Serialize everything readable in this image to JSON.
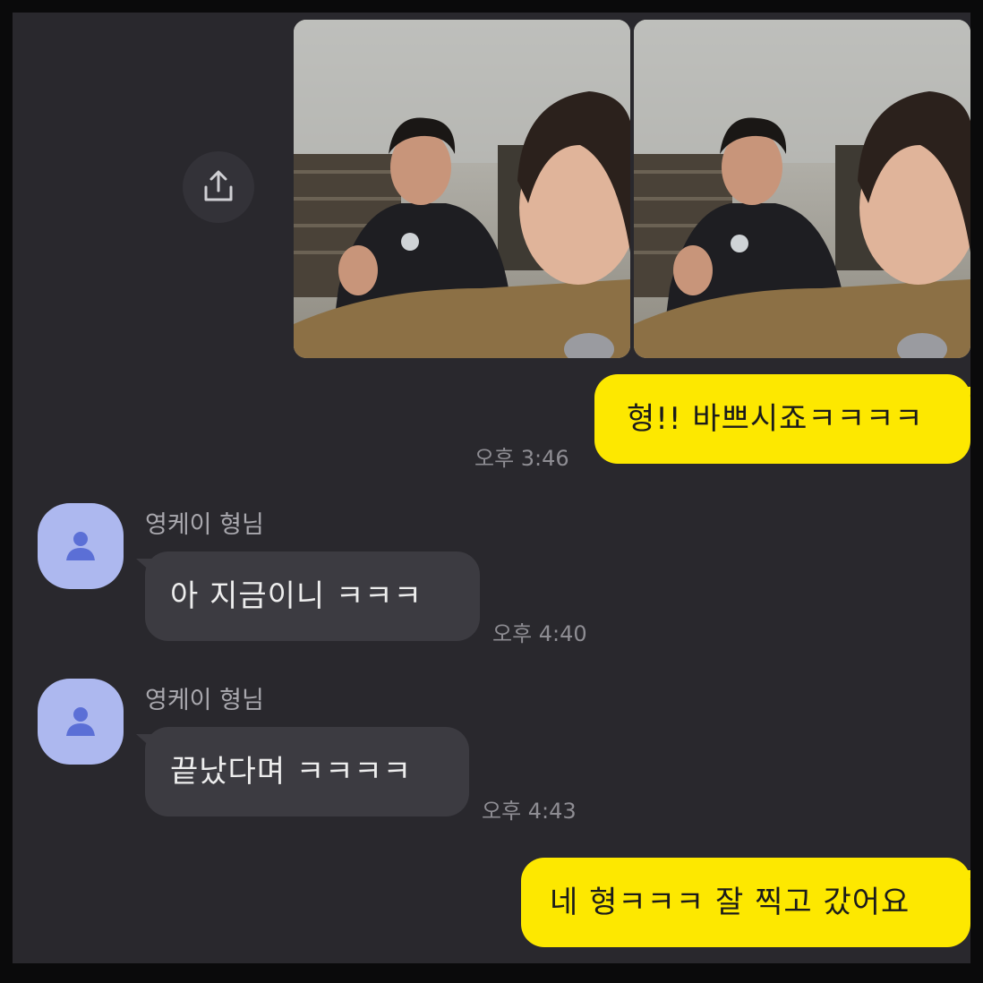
{
  "chat": {
    "share_icon": "share-upload-icon",
    "photos": [
      {
        "alt": "selfie-photo-1"
      },
      {
        "alt": "selfie-photo-2"
      }
    ],
    "messages": [
      {
        "sender": "",
        "text": "형!! 바쁘시죠ㅋㅋㅋㅋ",
        "time": "오후 3:46",
        "mine": true
      },
      {
        "sender": "영케이 형님",
        "text": "아 지금이니 ㅋㅋㅋ",
        "time": "오후 4:40",
        "mine": false
      },
      {
        "sender": "영케이 형님",
        "text": "끝났다며 ㅋㅋㅋㅋ",
        "time": "오후 4:43",
        "mine": false
      },
      {
        "sender": "",
        "text": "네 형ㅋㅋㅋ 잘 찍고 갔어요",
        "time": "",
        "mine": true
      }
    ]
  },
  "colors": {
    "background": "#29282d",
    "my_bubble": "#fde800",
    "their_bubble": "#3c3b41",
    "avatar": "#adb8ef"
  }
}
